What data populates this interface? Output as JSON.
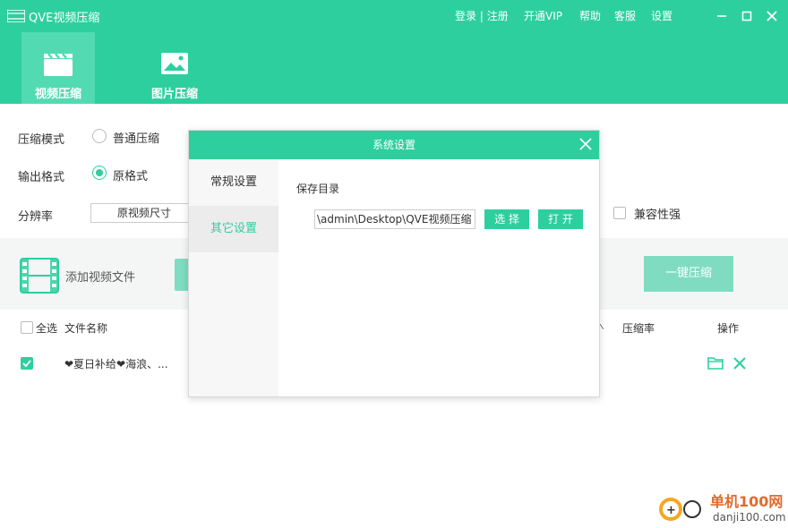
{
  "app": {
    "title": "QVE视频压缩",
    "top_links": {
      "login": "登录",
      "sep": " | ",
      "register": "注册",
      "vip": "开通VIP",
      "help": "帮助",
      "service": "客服",
      "settings": "设置"
    }
  },
  "tabs": [
    {
      "label": "视频压缩",
      "icon": "clapperboard-icon",
      "active": true
    },
    {
      "label": "图片压缩",
      "icon": "image-icon",
      "active": false
    }
  ],
  "options": {
    "mode_label": "压缩模式",
    "mode_option": "普通压缩",
    "format_label": "输出格式",
    "format_option": "原格式",
    "resolution_label": "分辨率",
    "resolution_value": "原视频尺寸",
    "compat_label": "兼容性强"
  },
  "toolbar": {
    "add_label": "添加视频文件",
    "compress_label": "一键压缩"
  },
  "list": {
    "select_all": "全选",
    "col_name": "文件名称",
    "col_ratio": "压缩率",
    "col_action": "操作",
    "rows": [
      {
        "name": "❤夏日补给❤海浪、...",
        "checked": true
      }
    ]
  },
  "dialog": {
    "title": "系统设置",
    "side_items": [
      "常规设置",
      "其它设置"
    ],
    "active_index": 1,
    "save_dir_label": "保存目录",
    "save_dir_value": "\\admin\\Desktop\\QVE视频压缩",
    "choose_label": "选 择",
    "open_label": "打 开"
  },
  "watermark": {
    "text": "单机100网",
    "url": "danji100.com"
  },
  "colors": {
    "accent": "#2ecf9e",
    "accent_light": "#7fdcc0"
  }
}
